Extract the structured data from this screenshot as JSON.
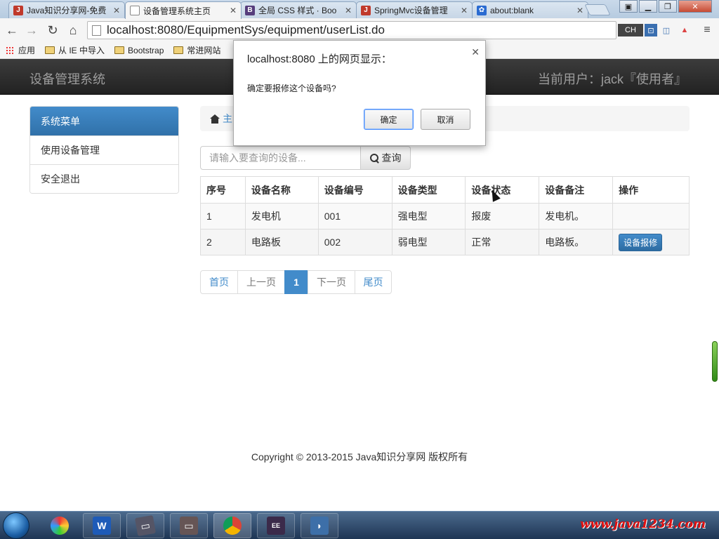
{
  "browser": {
    "tabs": [
      {
        "label": "Java知识分享网-免费",
        "icon": "J",
        "color": "#c0392b"
      },
      {
        "label": "设备管理系统主页",
        "icon": "",
        "color": "#888888"
      },
      {
        "label": "全局 CSS 样式 · Boo",
        "icon": "B",
        "color": "#563d7c"
      },
      {
        "label": "SpringMvc设备管理",
        "icon": "J",
        "color": "#c0392b"
      },
      {
        "label": "about:blank",
        "icon": "",
        "color": "#2a6bd1"
      }
    ],
    "url": "localhost:8080/EquipmentSys/equipment/userList.do",
    "bookmarks": [
      {
        "label": "应用",
        "icon": "apps-grid-icon"
      },
      {
        "label": "从 IE 中导入",
        "icon": "folder-icon"
      },
      {
        "label": "Bootstrap",
        "icon": "folder-icon"
      },
      {
        "label": "常进网站",
        "icon": "folder-icon"
      }
    ],
    "ime_label": "CH"
  },
  "app": {
    "brand": "设备管理系统",
    "current_user": "当前用户：jack『使用者』"
  },
  "sidebar": {
    "heading": "系统菜单",
    "items": [
      {
        "label": "使用设备管理"
      },
      {
        "label": "安全退出"
      }
    ]
  },
  "breadcrumb": {
    "home": "主"
  },
  "search": {
    "placeholder": "请输入要查询的设备...",
    "button_label": "查询"
  },
  "table": {
    "headers": [
      "序号",
      "设备名称",
      "设备编号",
      "设备类型",
      "设备状态",
      "设备备注",
      "操作"
    ],
    "rows": [
      {
        "id": "1",
        "name": "发电机",
        "code": "001",
        "type": "强电型",
        "status": "报废",
        "note": "发电机。",
        "action": ""
      },
      {
        "id": "2",
        "name": "电路板",
        "code": "002",
        "type": "弱电型",
        "status": "正常",
        "note": "电路板。",
        "action": "设备报修"
      }
    ]
  },
  "pagination": {
    "first": "首页",
    "prev": "上一页",
    "current": "1",
    "next": "下一页",
    "last": "尾页"
  },
  "footer": "Copyright © 2013-2015 Java知识分享网 版权所有",
  "dialog": {
    "title": "localhost:8080 上的网页显示：",
    "message": "确定要报修这个设备吗?",
    "ok_label": "确定",
    "cancel_label": "取消"
  },
  "taskbar": {
    "watermark": "www.java1234.com"
  },
  "colors": {
    "primary": "#428bca",
    "navbar": "#222222"
  }
}
